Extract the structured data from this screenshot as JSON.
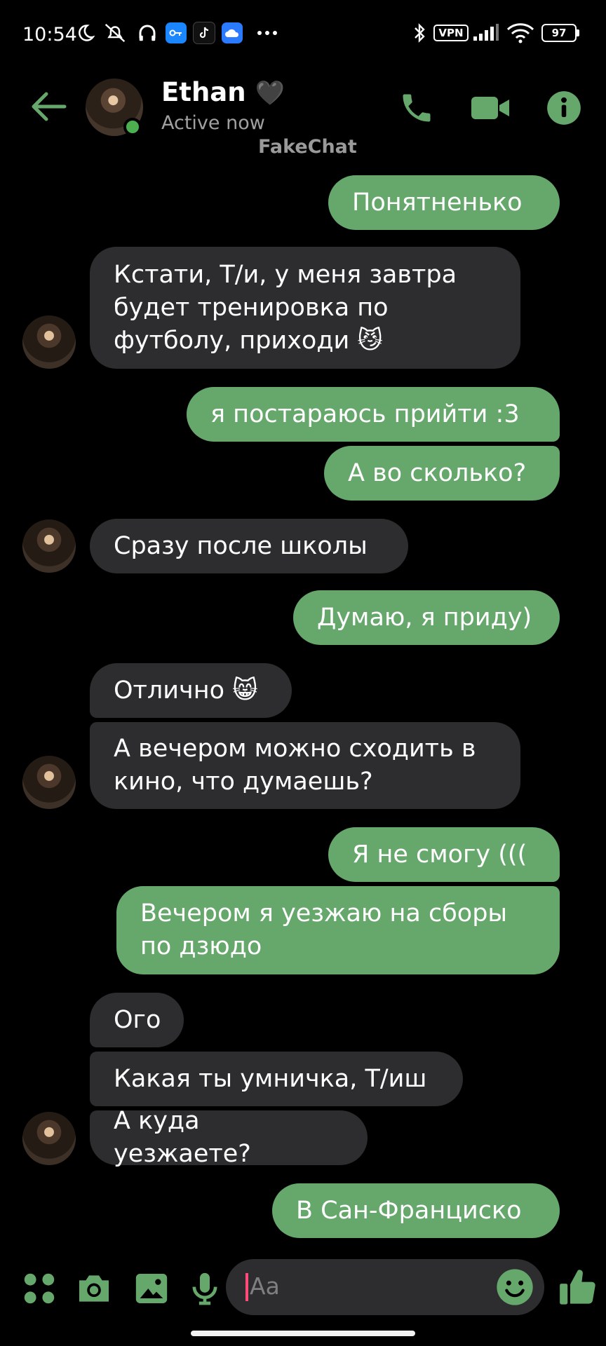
{
  "status_bar": {
    "time": "10:54",
    "vpn": "VPN",
    "battery": "97"
  },
  "header": {
    "name": "Ethan",
    "name_emoji": "🖤",
    "status": "Active now",
    "watermark": "FakeChat"
  },
  "messages": [
    {
      "side": "out",
      "text": "Понятненько"
    },
    {
      "side": "in",
      "text": "Кстати, Т/и, у меня завтра будет тренировка по футболу, приходи 😼"
    },
    {
      "side": "out",
      "text": "я постараюсь прийти :3"
    },
    {
      "side": "out",
      "text": "А во сколько?"
    },
    {
      "side": "in",
      "text": "Сразу после школы"
    },
    {
      "side": "out",
      "text": "Думаю, я приду)"
    },
    {
      "side": "in",
      "text": "Отлично 😸"
    },
    {
      "side": "in",
      "text": "А вечером можно сходить в кино, что думаешь?"
    },
    {
      "side": "out",
      "text": "Я не смогу ((("
    },
    {
      "side": "out",
      "text": "Вечером я уезжаю на сборы по дзюдо"
    },
    {
      "side": "in",
      "text": "Ого"
    },
    {
      "side": "in",
      "text": "Какая ты умничка, Т/иш"
    },
    {
      "side": "in",
      "text": "А куда уезжаете?"
    },
    {
      "side": "out",
      "text": "В Сан-Франциско"
    }
  ],
  "composer": {
    "placeholder": "Aa"
  },
  "icons": [
    "back-arrow-icon",
    "phone-icon",
    "video-icon",
    "info-icon",
    "apps-icon",
    "camera-icon",
    "gallery-icon",
    "mic-icon",
    "emoji-icon",
    "thumbs-up-icon"
  ],
  "colors": {
    "accent": "#66a86c",
    "incoming_bubble": "#2d2d30",
    "background": "#000000",
    "online": "#4caf50"
  }
}
